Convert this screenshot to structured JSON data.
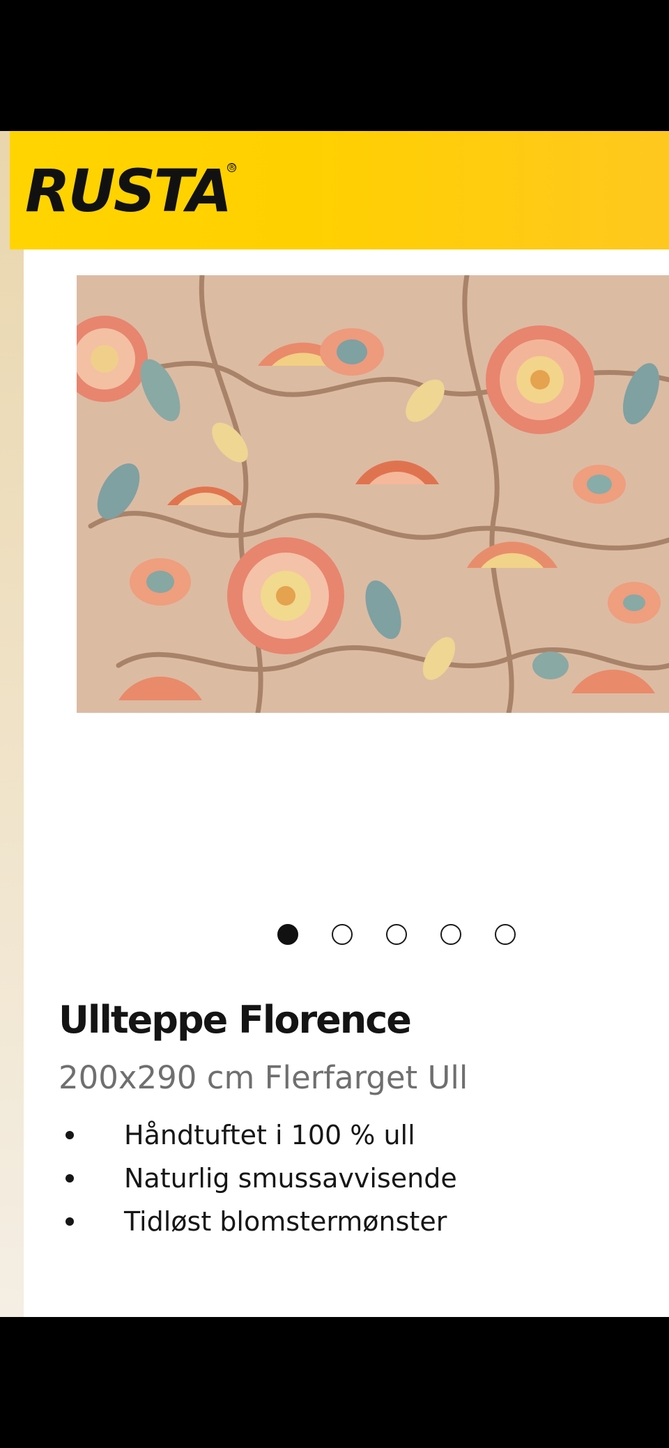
{
  "header": {
    "logo_text": "RUSTA",
    "brand_color": "#FFD400"
  },
  "gallery": {
    "image_alt": "Ullteppe Florence floral rug",
    "total_images": 5,
    "active_index": 0
  },
  "product": {
    "name": "Ullteppe Florence",
    "subtitle": "200x290 cm Flerfarget Ull",
    "features": [
      "Håndtuftet i 100 % ull",
      "Naturlig smussavvisende",
      "Tidløst blomstermønster"
    ]
  }
}
